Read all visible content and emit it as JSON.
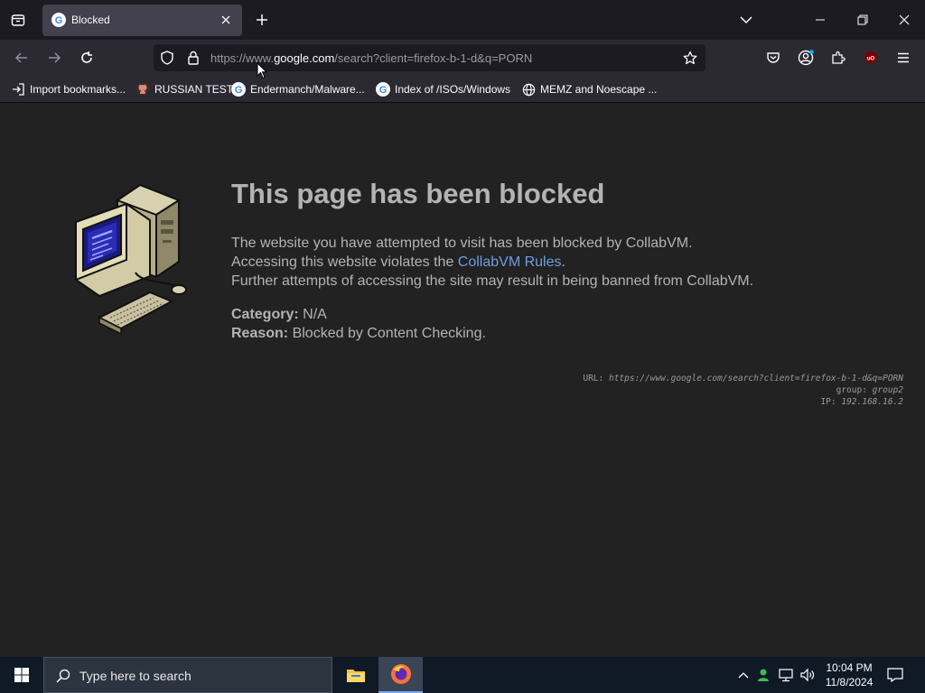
{
  "tab": {
    "title": "Blocked"
  },
  "address_bar": {
    "url_prefix": "https://www.",
    "url_host": "google.com",
    "url_rest": "/search?client=firefox-b-1-d&q=PORN"
  },
  "bookmarks": [
    {
      "label": "Import bookmarks...",
      "icon": "import-icon"
    },
    {
      "label": "RUSSIAN TEST",
      "icon": "github-icon"
    },
    {
      "label": "Endermanch/Malware...",
      "icon": "google-icon"
    },
    {
      "label": "Index of /ISOs/Windows",
      "icon": "google-icon"
    },
    {
      "label": "MEMZ and Noescape ...",
      "icon": "globe-icon"
    }
  ],
  "page": {
    "title": "This page has been blocked",
    "line1": "The website you have attempted to visit has been blocked by CollabVM.",
    "line2_before": "Accessing this website violates the ",
    "line2_link": "CollabVM Rules",
    "line2_after": ".",
    "line3": "Further attempts of accessing the site may result in being banned from CollabVM.",
    "category_label": "Category:",
    "category_value": "N/A",
    "reason_label": "Reason:",
    "reason_value": "Blocked by Content Checking.",
    "debug": {
      "url_label": "URL:",
      "url_value": "https://www.google.com/search?client=firefox-b-1-d&q=PORN",
      "group_label": "group:",
      "group_value": "group2",
      "ip_label": "IP:",
      "ip_value": "192.168.16.2"
    }
  },
  "taskbar": {
    "search_placeholder": "Type here to search",
    "time": "10:04 PM",
    "date": "11/8/2024"
  },
  "colors": {
    "link": "#6e9ee0",
    "accent_orange": "#ff7139",
    "ublock_red": "#800000"
  }
}
